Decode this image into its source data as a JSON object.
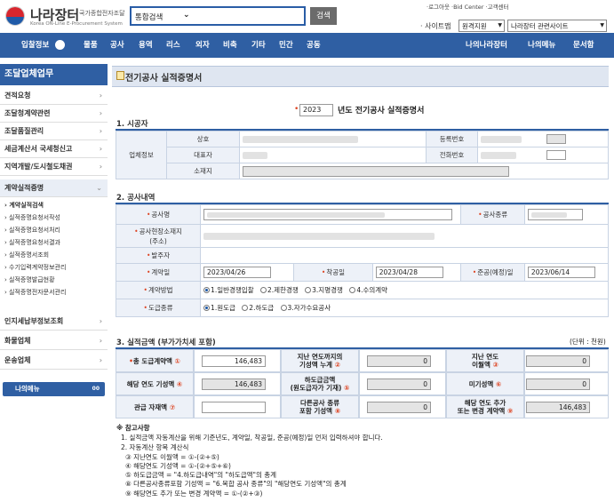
{
  "header": {
    "logo_title": "나라장터",
    "logo_sub": "국가종합전자조달",
    "logo_eng": "Korea ON-Line E-Procurement System",
    "search_scope": "통합검색",
    "search_button": "검색",
    "top_links": "·로그아웃 ·Bid Center ·고객센터",
    "sitemap": "· 사이트맵",
    "region_select": "원격지원",
    "related_select": "나라장터 관련사이트"
  },
  "nav": {
    "items": [
      "입찰정보",
      "물품",
      "공사",
      "용역",
      "리스",
      "외자",
      "비축",
      "기타",
      "민간",
      "공동"
    ],
    "right_items": [
      "나의나라장터",
      "나의메뉴",
      "문서함"
    ]
  },
  "sidebar": {
    "title": "조달업체업무",
    "items": [
      "견적요청",
      "조달청계약관련",
      "조달품질관리",
      "세금계산서 국세청신고",
      "지역개발/도시철도채권",
      "계약실적증명"
    ],
    "sub_items": [
      "계약실적검색",
      "실적증명요청서작성",
      "실적증명요청서처리",
      "실적증명요청서결과",
      "실적증명서조회",
      "수기입력계약정보관리",
      "실적증명발급현황",
      "실적증명전자문서관리"
    ],
    "items_after": [
      "인지세납부정보조회",
      "화물업체",
      "운송업체"
    ],
    "mymenu": "나의메뉴"
  },
  "page": {
    "title": "전기공사 실적증명서",
    "year": "2023",
    "year_suffix": "년도 전기공사 실적증명서"
  },
  "section1": {
    "heading": "1. 시공자",
    "group_label": "업체정보",
    "labels": [
      "상호",
      "대표자",
      "소재지",
      "등록번호",
      "전화번호"
    ]
  },
  "section2": {
    "heading": "2. 공사내역",
    "labels": {
      "name": "공사명",
      "type": "공사종류",
      "site": "공사현장소재지",
      "site2": "(주소)",
      "client": "발주자",
      "contract_date": "계약일",
      "start_date": "착공일",
      "complete_date": "준공(예정)일",
      "contract_method": "계약방법",
      "subcontract_type": "도급종류"
    },
    "values": {
      "contract_date": "2023/04/26",
      "start_date": "2023/04/28",
      "complete_date": "2023/06/14"
    },
    "contract_methods": [
      "1.일반경쟁입찰",
      "2.제한경쟁",
      "3.지명경쟁",
      "4.수의계약"
    ],
    "subcontract_types": [
      "1.원도급",
      "2.하도급",
      "3.자가수요공사"
    ]
  },
  "section3": {
    "heading": "3. 실적금액 (부가가치세 포함)",
    "unit": "(단위 : 천원)",
    "rows": [
      [
        {
          "label": "총 도급계약액",
          "num": "①",
          "value": "146,483",
          "ro": false
        },
        {
          "label": "지난 연도까지의\n기성액 누계",
          "num": "②",
          "value": "0",
          "ro": true
        },
        {
          "label": "지난 연도\n이월액",
          "num": "③",
          "value": "0",
          "ro": true
        }
      ],
      [
        {
          "label": "해당 연도 기성액",
          "num": "④",
          "value": "146,483",
          "ro": true
        },
        {
          "label": "하도급금액\n(원도급자가 기재)",
          "num": "⑤",
          "value": "0",
          "ro": true
        },
        {
          "label": "미기성액",
          "num": "⑥",
          "value": "0",
          "ro": true
        }
      ],
      [
        {
          "label": "관급 자재액",
          "num": "⑦",
          "value": "",
          "ro": false
        },
        {
          "label": "다른공사 종류\n포함 기성액",
          "num": "⑧",
          "value": "0",
          "ro": true
        },
        {
          "label": "해당 연도 추가\n또는 변경 계약액",
          "num": "⑨",
          "value": "146,483",
          "ro": true
        }
      ]
    ]
  },
  "notes": {
    "title": "※ 참고사항",
    "lines": [
      "1. 실적금액 자동계산을 위해 기준년도, 계약일, 착공일, 준공(예정)일 먼저 입력하셔야 합니다.",
      "2. 자동계산 항목 계산식",
      "③ 지난연도 이월액 = ①-(②+⑤)",
      "④ 해당연도 기성액 = ①-(②+⑤+⑥)",
      "⑤ 하도급금액 = \"4.하도급내역\"의 \"하도급액\"의 총계",
      "⑧ 다른공사종류포함 기성액 = \"6.복합 공사 종류\"의 \"해당연도 기성액\"의 총계",
      "⑨ 해당연도 추가 또는 변경 계약액 = ①-(②+③)"
    ]
  }
}
